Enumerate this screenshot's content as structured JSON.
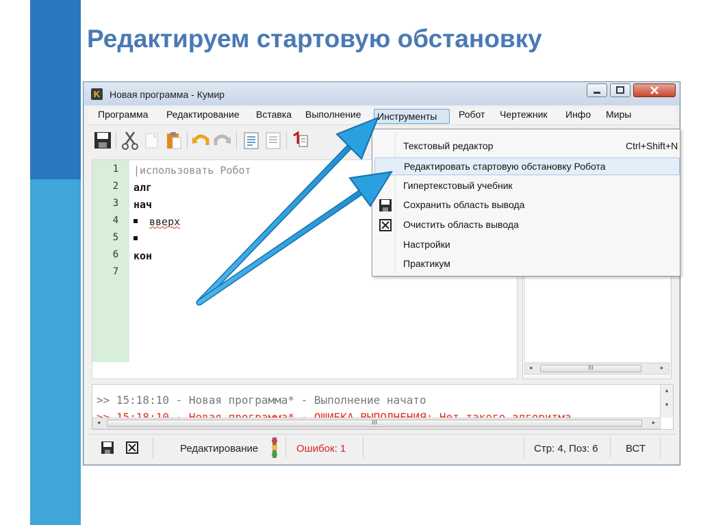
{
  "slide": {
    "title": "Редактируем стартовую обстановку",
    "colors": {
      "accent_dark": "#2a77bd",
      "accent_light": "#3ea6d9",
      "title": "#4a7ab4"
    }
  },
  "window": {
    "icon_letter": "K",
    "title": "Новая программа - Кумир",
    "minimize_icon": "minimize-icon",
    "maximize_icon": "maximize-icon",
    "close_icon": "close-icon"
  },
  "menu": {
    "items": [
      {
        "label": "Программа"
      },
      {
        "label": "Редактирование"
      },
      {
        "label": "Вставка"
      },
      {
        "label": "Выполнение"
      },
      {
        "label": "Инструменты",
        "active": true
      },
      {
        "label": "Робот"
      },
      {
        "label": "Чертежник"
      },
      {
        "label": "Инфо"
      },
      {
        "label": "Миры"
      }
    ]
  },
  "toolbar": {
    "icons": [
      "save-icon",
      "cut-icon",
      "copy-icon",
      "paste-icon",
      "undo-icon",
      "redo-icon",
      "indent-icon",
      "outdent-icon",
      "run-icon"
    ]
  },
  "editor": {
    "line_numbers": [
      "1",
      "2",
      "3",
      "4",
      "5",
      "6",
      "7"
    ],
    "lines": [
      "|использовать Робот",
      "алг",
      "нач",
      "вверх",
      "",
      "кон",
      ""
    ]
  },
  "tools_menu": {
    "items": [
      {
        "label": "Текстовый редактор",
        "shortcut": "Ctrl+Shift+N"
      },
      {
        "label": "Редактировать стартовую обстановку Робота",
        "highlighted": true
      },
      {
        "label": "Гипертекстовый учебник"
      },
      {
        "label": "Сохранить область вывода",
        "icon": "save-icon"
      },
      {
        "label": "Очистить область вывода",
        "icon": "clear-icon"
      },
      {
        "label": "Настройки"
      },
      {
        "label": "Практикум"
      }
    ]
  },
  "output": {
    "lines": [
      ">> 15:18:10 - Новая программа* - Выполнение начато",
      ">> 15:18:10 - Новая программа* - ОШИБКА ВЫПОЛНЕНИЯ: Нет такого алгоритма"
    ],
    "colors": {
      "normal": "#777777",
      "error": "#e03020"
    }
  },
  "scrollbars": {
    "thumb_glyph": "III",
    "left_arrow": "◂",
    "right_arrow": "▸",
    "up_arrow": "▴",
    "down_arrow": "▾"
  },
  "statusbar": {
    "mode": "Редактирование",
    "errors": "Ошибок: 1",
    "position": "Стр: 4, Поз: 6",
    "insert_mode": "ВСТ",
    "icons": [
      "save-icon",
      "clear-icon",
      "traffic-light-icon"
    ]
  },
  "annotation": {
    "arrow_color": "#2aa0e0",
    "arrow_icon": "pointer-arrow-icon"
  }
}
